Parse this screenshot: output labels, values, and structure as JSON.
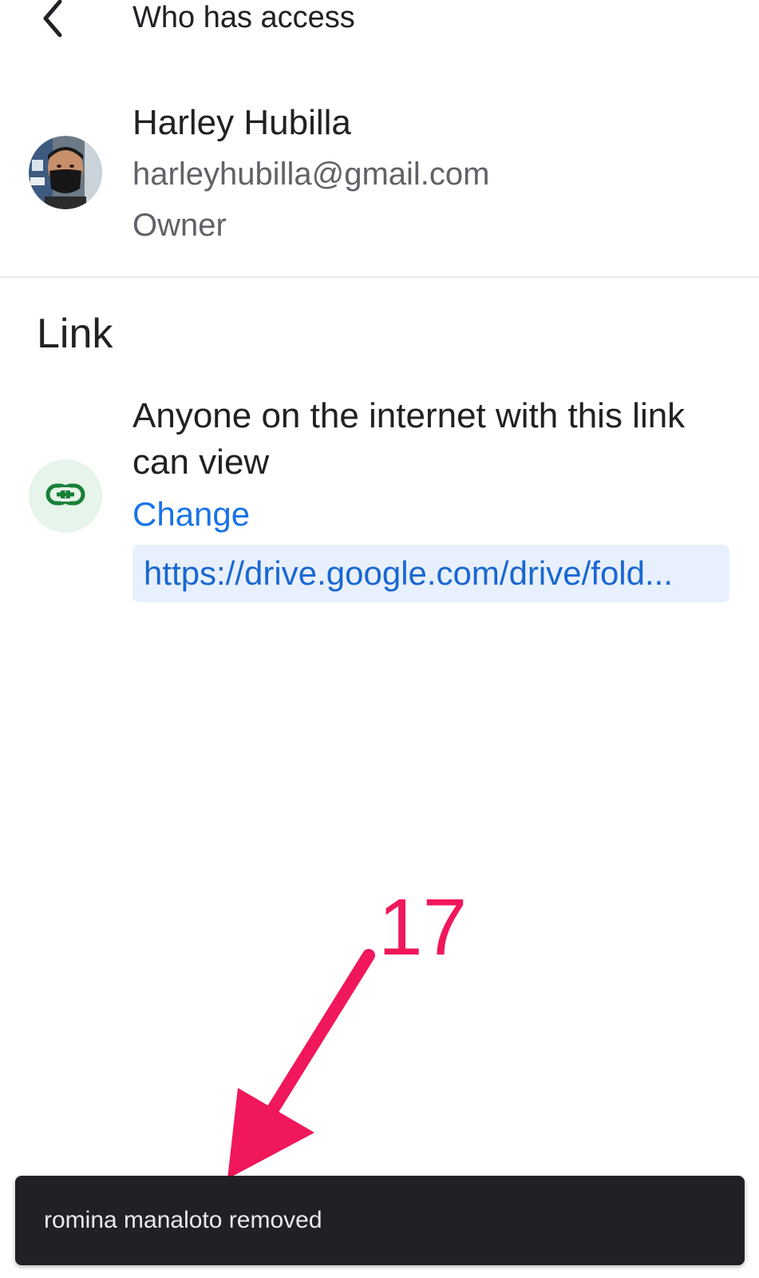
{
  "header": {
    "back_icon": "arrow-back-icon",
    "title": "Who has access"
  },
  "owner": {
    "name": "Harley Hubilla",
    "email": "harleyhubilla@gmail.com",
    "role": "Owner"
  },
  "link_section": {
    "title": "Link",
    "icon": "link-icon",
    "description": "Anyone on the internet with this link can view",
    "change_label": "Change",
    "url": "https://drive.google.com/drive/fold..."
  },
  "annotation": {
    "number": "17",
    "color": "#f0175a"
  },
  "snackbar": {
    "message": "romina manaloto removed"
  },
  "colors": {
    "accent": "#1a73e8",
    "link_icon_green": "#188038",
    "link_icon_bg": "#e6f4ea",
    "url_bg": "#e8f0fe",
    "snackbar_bg": "#202124"
  }
}
